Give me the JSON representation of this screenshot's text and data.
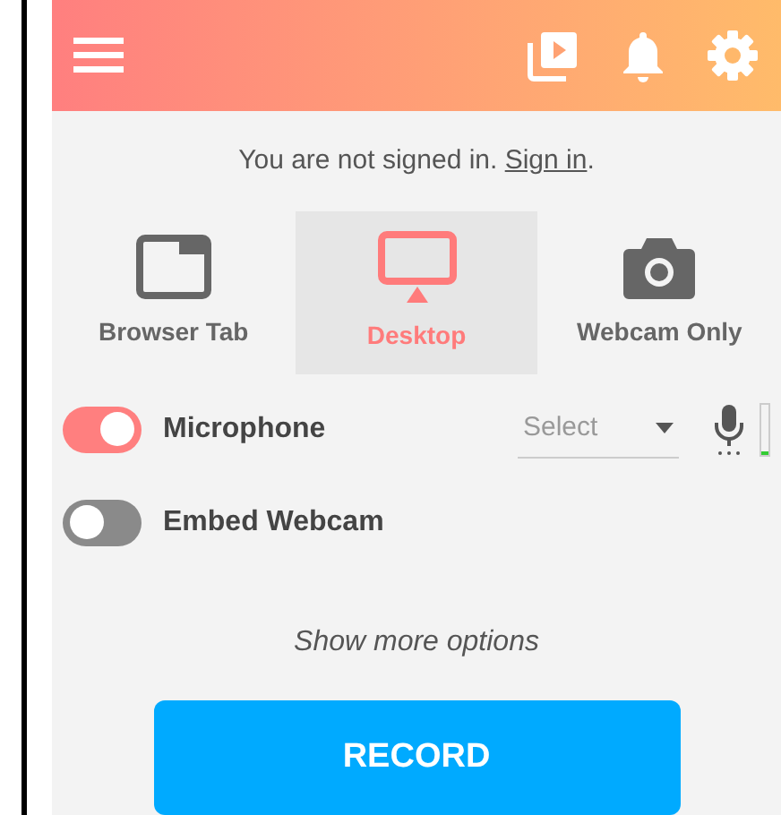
{
  "signin": {
    "text": "You are not signed in.",
    "link": "Sign in",
    "after": "."
  },
  "modes": [
    {
      "label": "Browser Tab",
      "kind": "tab",
      "selected": false
    },
    {
      "label": "Desktop",
      "kind": "desktop",
      "selected": true
    },
    {
      "label": "Webcam Only",
      "kind": "camera",
      "selected": false
    }
  ],
  "options": [
    {
      "label": "Microphone",
      "on": true,
      "select": {
        "placeholder": "Select"
      },
      "mic_meter": {
        "level": 0.05
      }
    },
    {
      "label": "Embed Webcam",
      "on": false
    }
  ],
  "more_options": "Show more options",
  "record_button": "RECORD"
}
